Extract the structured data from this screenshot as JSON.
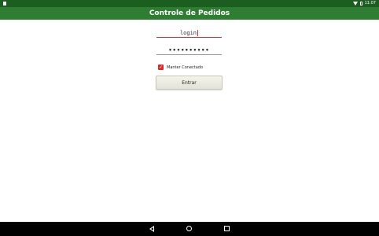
{
  "status_bar": {
    "time": "11:07",
    "icons": [
      "notification-icon",
      "wifi-icon",
      "battery-icon"
    ]
  },
  "app_bar": {
    "title": "Controle de Pedidos"
  },
  "login_form": {
    "login_value": "login",
    "password_value": "••••••••••",
    "keep_connected_label": "Manter Conectado",
    "keep_connected_checked": true,
    "submit_label": "Entrar"
  },
  "colors": {
    "status_bar": "#1b5e20",
    "app_bar": "#2e7d32",
    "accent": "#d32f2f",
    "nav_bar": "#000000"
  },
  "nav_bar": {
    "buttons": [
      "back-icon",
      "home-icon",
      "recent-apps-icon"
    ]
  }
}
